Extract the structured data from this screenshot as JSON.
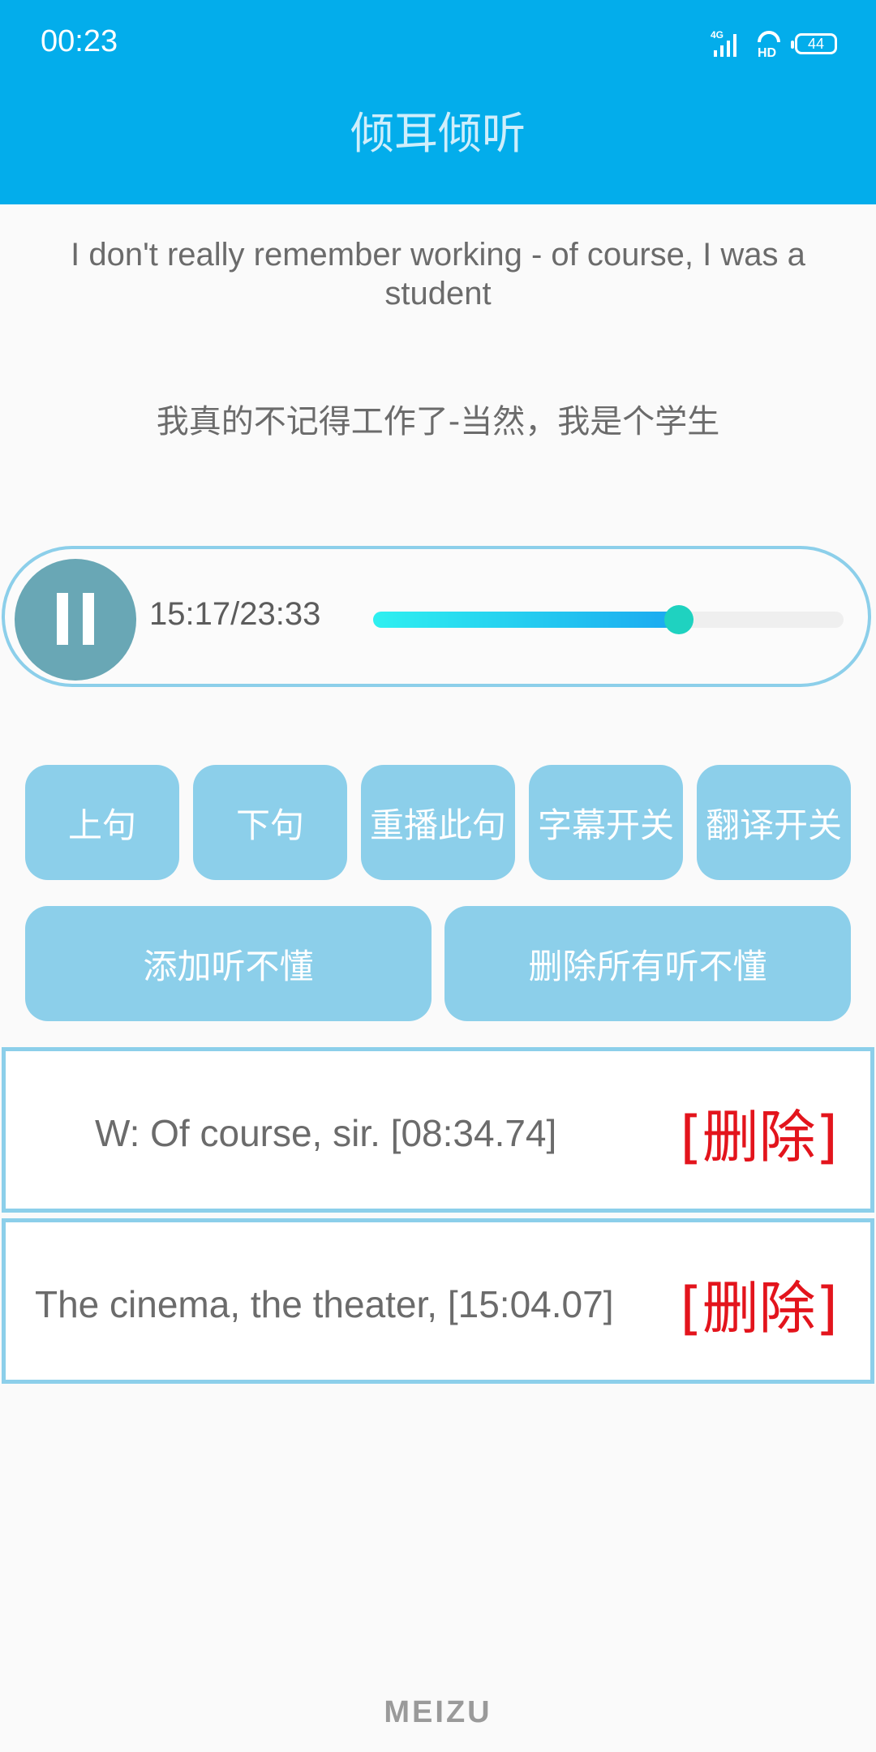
{
  "status_bar": {
    "time": "00:23",
    "network_label": "4G",
    "hd_label": "HD",
    "battery_level": "44"
  },
  "header": {
    "title": "倾耳倾听"
  },
  "subtitle": {
    "english": "I don't really remember working - of course, I was a student",
    "chinese": "我真的不记得工作了-当然，我是个学生"
  },
  "player": {
    "state": "playing",
    "time_readout": "15:17/23:33",
    "progress_fraction": 0.65
  },
  "controls": {
    "prev_label": "上句",
    "next_label": "下句",
    "replay_label": "重播此句",
    "subtitle_toggle_label": "字幕开关",
    "translation_toggle_label": "翻译开关",
    "add_unclear_label": "添加听不懂",
    "delete_all_unclear_label": "删除所有听不懂"
  },
  "unclear_list": {
    "items": [
      {
        "text": "W: Of course, sir. [08:34.74]",
        "delete_label": "[删除]"
      },
      {
        "text": "The cinema, the theater, [15:04.07]",
        "delete_label": "[删除]"
      }
    ]
  },
  "footer": {
    "brand": "MEIZU"
  },
  "colors": {
    "header_bg": "#03adeb",
    "button_bg": "#8ccfea",
    "delete_red": "#e3141c",
    "play_button": "#69a7b5"
  },
  "icons": {
    "play_toggle": "pause-icon",
    "signal": "signal-icon",
    "battery": "battery-icon"
  }
}
